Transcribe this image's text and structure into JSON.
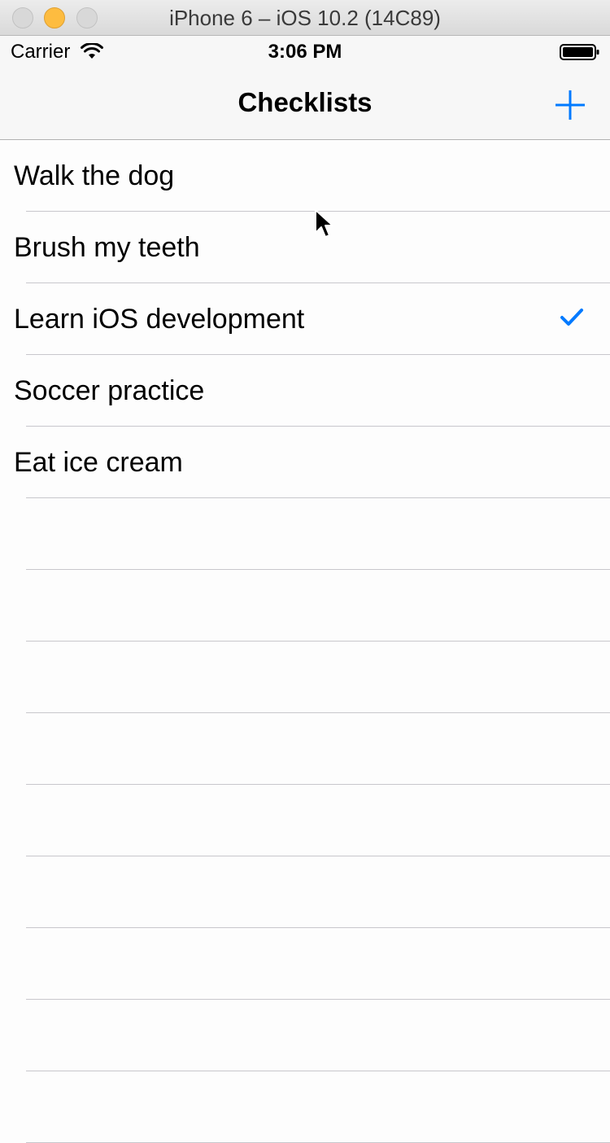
{
  "window": {
    "title": "iPhone 6 – iOS 10.2 (14C89)"
  },
  "status_bar": {
    "carrier": "Carrier",
    "time": "3:06 PM",
    "wifi_icon": "wifi-icon",
    "battery_icon": "battery-icon"
  },
  "nav_bar": {
    "title": "Checklists",
    "add_icon": "plus-icon"
  },
  "checklist": {
    "items": [
      {
        "label": "Walk the dog",
        "checked": false
      },
      {
        "label": "Brush my teeth",
        "checked": false
      },
      {
        "label": "Learn iOS development",
        "checked": true
      },
      {
        "label": "Soccer practice",
        "checked": false
      },
      {
        "label": "Eat ice cream",
        "checked": false
      }
    ]
  },
  "colors": {
    "tint": "#007aff",
    "separator": "#c8c7cc",
    "minimize_button": "#fdbc40"
  }
}
